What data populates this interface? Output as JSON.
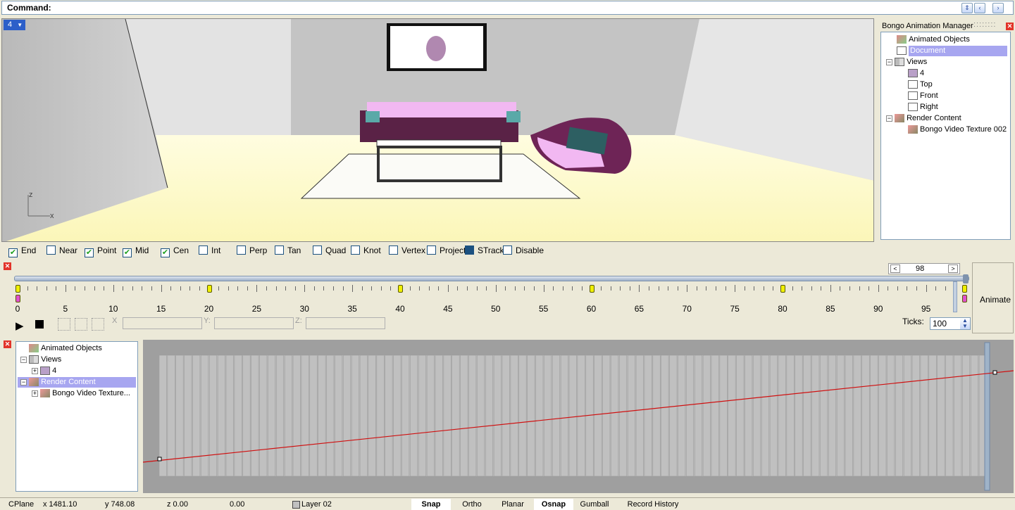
{
  "command": {
    "label": "Command:"
  },
  "viewport": {
    "badge": "4",
    "axis_z": "z",
    "axis_x": "x"
  },
  "bam": {
    "title": "Bongo Animation Manager",
    "tree": [
      {
        "label": "Animated Objects"
      },
      {
        "label": "Document"
      },
      {
        "label": "Views"
      },
      {
        "label": "4"
      },
      {
        "label": "Top"
      },
      {
        "label": "Front"
      },
      {
        "label": "Right"
      },
      {
        "label": "Render Content"
      },
      {
        "label": "Bongo Video Texture 002"
      }
    ]
  },
  "osnap": [
    {
      "label": "End",
      "checked": true
    },
    {
      "label": "Near",
      "checked": false
    },
    {
      "label": "Point",
      "checked": true
    },
    {
      "label": "Mid",
      "checked": true
    },
    {
      "label": "Cen",
      "checked": true
    },
    {
      "label": "Int",
      "checked": false
    },
    {
      "label": "Perp",
      "checked": false
    },
    {
      "label": "Tan",
      "checked": false
    },
    {
      "label": "Quad",
      "checked": false
    },
    {
      "label": "Knot",
      "checked": false
    },
    {
      "label": "Vertex",
      "checked": false
    },
    {
      "label": "Project",
      "checked": false
    },
    {
      "label": "STrack",
      "checked": true
    },
    {
      "label": "Disable",
      "checked": false
    }
  ],
  "timeline": {
    "current_frame": "98",
    "ticks_label": "Ticks:",
    "ticks_value": "100",
    "animate_label": "Animate",
    "numbers": [
      "0",
      "5",
      "10",
      "15",
      "20",
      "25",
      "30",
      "35",
      "40",
      "45",
      "50",
      "55",
      "60",
      "65",
      "70",
      "75",
      "80",
      "85",
      "90",
      "95"
    ],
    "keys": [
      0,
      20,
      40,
      60,
      80,
      99
    ],
    "axis_x": "X",
    "axis_y": "Y:",
    "axis_z": "Z:"
  },
  "left_tree": [
    {
      "label": "Animated Objects"
    },
    {
      "label": "Views"
    },
    {
      "label": "4"
    },
    {
      "label": "Render Content"
    },
    {
      "label": "Bongo Video Texture..."
    }
  ],
  "status": {
    "cplane": "CPlane",
    "x": "x 1481.10",
    "y": "y 748.08",
    "z": "z 0.00",
    "d": "0.00",
    "layer": "Layer 02",
    "buttons": [
      "Snap",
      "Ortho",
      "Planar",
      "Osnap",
      "Gumball",
      "Record History"
    ]
  },
  "colors": {
    "accent": "#2c5fc9",
    "selection": "#a7a6f0",
    "curve": "#d01010",
    "key": "#f0f000"
  }
}
